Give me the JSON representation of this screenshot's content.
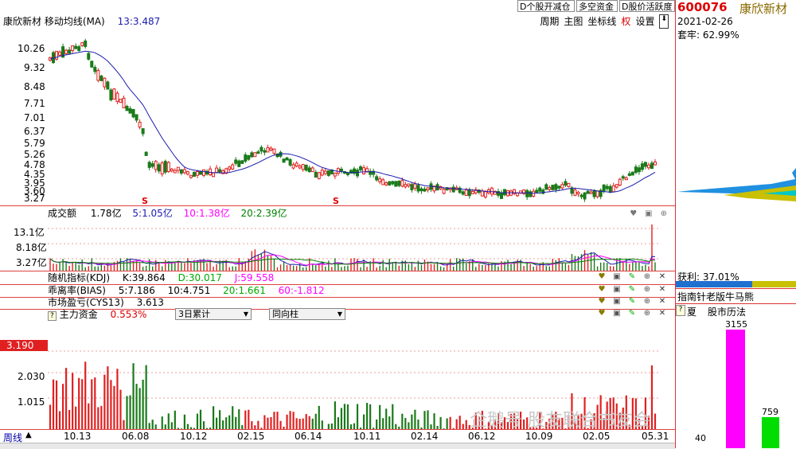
{
  "header": {
    "title": "康欣新材 移动均线(MA)",
    "ma_value": "13:3.487",
    "buttons": [
      "D个股开减仓",
      "多空资金",
      "D股价活跃度"
    ],
    "menu": [
      "周期",
      "主图",
      "坐标线",
      "权",
      "设置"
    ],
    "down_arrow": "⬇"
  },
  "side": {
    "code": "600076",
    "name": "康欣新材",
    "date": "2021-02-26",
    "taolao": "套牢: 62.99%",
    "huoli": "获利: 37.01%",
    "zhinan": "指南针老版牛马熊",
    "xia_label": "夏",
    "history_label": "股市历法",
    "history_value_1": "3155",
    "history_value_2": "759",
    "history_value_3": "40"
  },
  "price_axis": [
    "10.26",
    "9.32",
    "8.48",
    "7.71",
    "7.01",
    "6.37",
    "5.79",
    "5.26",
    "4.78",
    "4.35",
    "3.95",
    "3.60",
    "3.27"
  ],
  "vol_panel": {
    "label": "成交额",
    "v": "1.78亿",
    "ma5": "5:1.05亿",
    "ma10": "10:1.38亿",
    "ma20": "20:2.39亿",
    "axis": [
      "13.1亿",
      "8.18亿",
      "3.27亿"
    ]
  },
  "indicators": {
    "kdj": {
      "label": "随机指标(KDJ)",
      "k": "K:39.864",
      "d": "D:30.017",
      "j": "J:59.558"
    },
    "bias": {
      "label": "乖离率(BIAS)",
      "v5": "5:7.186",
      "v10": "10:4.751",
      "v20": "20:1.661",
      "v60": "60:-1.812"
    },
    "cys": {
      "label": "市场盈亏(CYS13)",
      "v": "3.613"
    },
    "zhuli": {
      "label": "主力资金",
      "v": "0.553%",
      "sel1": "3日累计",
      "sel2": "同向柱"
    }
  },
  "bottom_panel": {
    "axis": [
      "3.190",
      "2.030",
      "1.015"
    ]
  },
  "x_axis": [
    "周线",
    "10.13",
    "06.08",
    "10.12",
    "02.15",
    "06.14",
    "10.11",
    "02.14",
    "06.12",
    "10.09",
    "02.05",
    "05.31"
  ],
  "watermark": "企鹅号 股友联合书友会",
  "markers": [
    "S",
    "S"
  ],
  "colors": {
    "up": "#e02020",
    "down": "#1a7a1a",
    "ma": "#1c1cb0",
    "pink": "#ff00ff",
    "green": "#00cc00"
  }
}
